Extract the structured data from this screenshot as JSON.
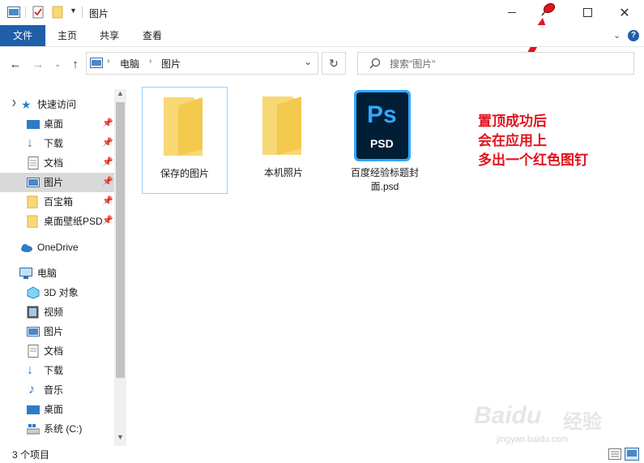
{
  "window": {
    "title": "图片"
  },
  "ribbon": {
    "tabs": [
      "文件",
      "主页",
      "共享",
      "查看"
    ]
  },
  "address": {
    "crumbs": [
      "电脑",
      "图片"
    ]
  },
  "search": {
    "placeholder": "搜索\"图片\""
  },
  "sidebar": {
    "quick_access": "快速访问",
    "pinned": [
      "桌面",
      "下载",
      "文档",
      "图片",
      "百宝箱",
      "桌面壁纸PSD"
    ],
    "onedrive": "OneDrive",
    "this_pc": "电脑",
    "pc_items": [
      "3D 对象",
      "视频",
      "图片",
      "文档",
      "下载",
      "音乐",
      "桌面",
      "系统 (C:)"
    ]
  },
  "files": [
    {
      "name": "保存的图片",
      "type": "folder"
    },
    {
      "name": "本机照片",
      "type": "folder"
    },
    {
      "name": "百度经验标题封面.psd",
      "type": "psd",
      "line1": "百度经验标题封",
      "line2": "面.psd",
      "icon_text": "Ps",
      "icon_sub": "PSD"
    }
  ],
  "annotation": {
    "lines": [
      "置顶成功后",
      "会在应用上",
      "多出一个红色图钉"
    ]
  },
  "status": {
    "count": "3 个项目"
  },
  "watermark": {
    "brand": "Baidu",
    "brand2": "经验",
    "url": "jingyan.baidu.com"
  },
  "colors": {
    "accent": "#1f5faa",
    "folder": "#f8d775",
    "annotation_red": "#e0141e",
    "ps_blue": "#31a8ff",
    "ps_bg": "#001e36"
  }
}
